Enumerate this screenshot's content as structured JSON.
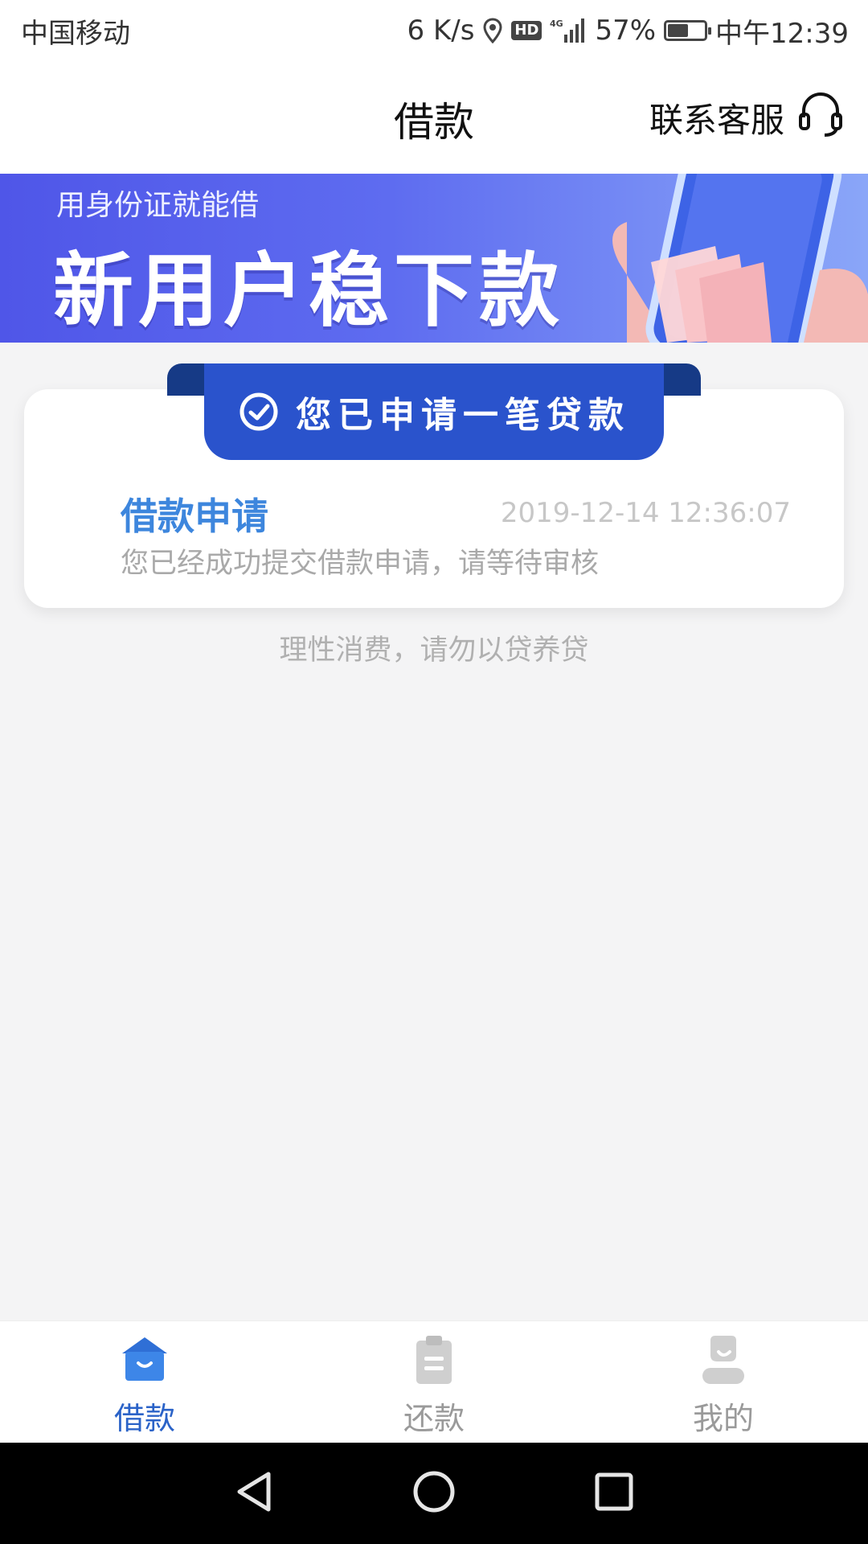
{
  "status_bar": {
    "carrier": "中国移动",
    "speed": "6 K/s",
    "network": "4G",
    "battery": "57%",
    "battery_level": 0.57,
    "time": "中午12:39"
  },
  "header": {
    "title": "借款",
    "service_label": "联系客服"
  },
  "banner": {
    "subtitle": "用身份证就能借",
    "headline": "新用户稳下款"
  },
  "application_card": {
    "ribbon_label": "您已申请一笔贷款",
    "title": "借款申请",
    "timestamp": "2019-12-14 12:36:07",
    "description": "您已经成功提交借款申请，请等待审核"
  },
  "tip": "理性消费，请勿以贷养贷",
  "tabbar": {
    "items": [
      {
        "label": "借款",
        "icon": "shop-icon",
        "active": true
      },
      {
        "label": "还款",
        "icon": "clipboard-icon",
        "active": false
      },
      {
        "label": "我的",
        "icon": "user-icon",
        "active": false
      }
    ]
  },
  "colors": {
    "accent": "#2b63c8",
    "card_title": "#3d86dd",
    "ribbon": "#2a53cc",
    "banner_start": "#4f56e8"
  }
}
